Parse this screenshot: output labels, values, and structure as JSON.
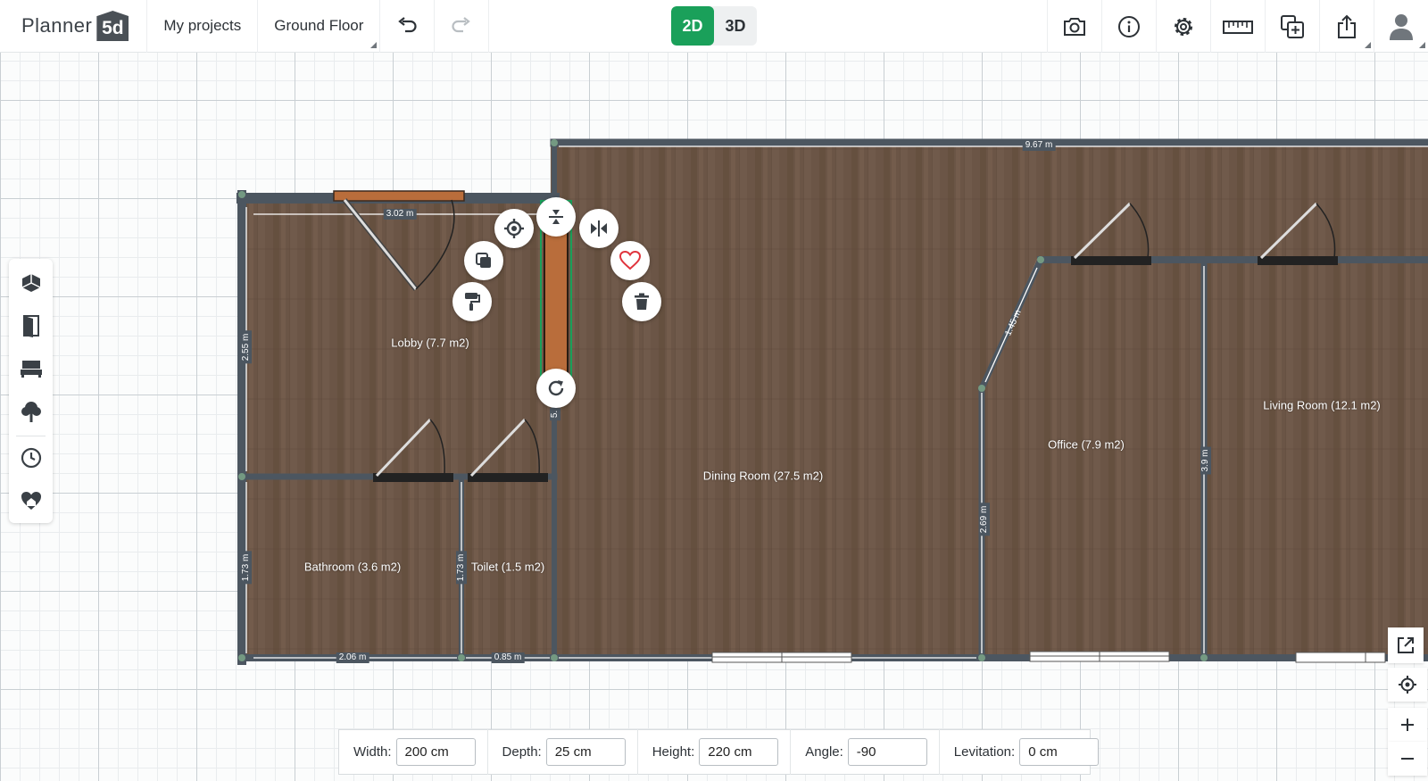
{
  "header": {
    "logo_text": "Planner",
    "logo_badge": "5d",
    "my_projects": "My projects",
    "floor": "Ground Floor",
    "view_2d": "2D",
    "view_3d": "3D",
    "icons": [
      "undo-icon",
      "redo-icon",
      "camera-icon",
      "info-icon",
      "settings-icon",
      "ruler-icon",
      "add-floor-icon",
      "share-icon",
      "user-avatar-icon"
    ]
  },
  "left_toolbar": [
    "construction-icon",
    "doors-windows-icon",
    "furniture-icon",
    "plants-icon",
    "history-icon",
    "favorites-icon"
  ],
  "rooms": [
    {
      "name": "Lobby (7.7 m2)"
    },
    {
      "name": "Bathroom (3.6 m2)"
    },
    {
      "name": "Toilet (1.5 m2)"
    },
    {
      "name": "Dining Room (27.5 m2)"
    },
    {
      "name": "Office (7.9 m2)"
    },
    {
      "name": "Living Room (12.1 m2)"
    }
  ],
  "dimensions": {
    "top_long": "9.67 m",
    "lobby_top": "3.02 m",
    "lobby_left": "2.55 m",
    "bath_left": "1.73 m",
    "toilet_left": "1.73 m",
    "bottom_bath": "2.06 m",
    "bottom_toilet": "0.85 m",
    "diag": "1.45 m",
    "office_left": "2.69 m",
    "living_left": "3.9 m",
    "selected": "5."
  },
  "selection_controls": [
    "vertical-flip-icon",
    "center-icon",
    "horizontal-flip-icon",
    "duplicate-icon",
    "favorite-heart-icon",
    "paint-roller-icon",
    "delete-trash-icon",
    "rotate-icon"
  ],
  "right_controls": [
    "expand-icon",
    "locate-icon",
    "zoom-in-icon",
    "zoom-out-icon"
  ],
  "properties": {
    "width_label": "Width:",
    "width_value": "200 cm",
    "depth_label": "Depth:",
    "depth_value": "25 cm",
    "height_label": "Height:",
    "height_value": "220 cm",
    "angle_label": "Angle:",
    "angle_value": "-90",
    "levitation_label": "Levitation:",
    "levitation_value": "0 cm"
  },
  "colors": {
    "accent_green": "#1aa05a",
    "floor_wood": "#6b5546",
    "wall": "#4c5660",
    "selected_door": "#b96d3b",
    "heart": "#e0343d"
  }
}
